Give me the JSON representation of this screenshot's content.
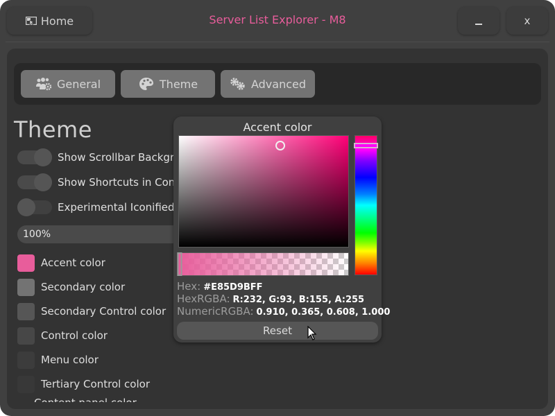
{
  "window": {
    "title": "Server List Explorer - M8",
    "home_label": "Home",
    "home_icon": "image-cursor-icon",
    "minimize_label": "_",
    "close_label": "x"
  },
  "tabs": [
    {
      "label": "General",
      "icon": "users-gear-icon",
      "active": false
    },
    {
      "label": "Theme",
      "icon": "palette-icon",
      "active": true
    },
    {
      "label": "Advanced",
      "icon": "gears-icon",
      "active": false
    }
  ],
  "section": {
    "title": "Theme"
  },
  "toggles": [
    {
      "label": "Show Scrollbar Background",
      "on": true
    },
    {
      "label": "Show Shortcuts in Context Menu",
      "on": true
    },
    {
      "label": "Experimental Iconified Menu",
      "on": false
    }
  ],
  "scale": {
    "value": "100%"
  },
  "colors": [
    {
      "label": "Accent color",
      "hex": "#e85d9b"
    },
    {
      "label": "Secondary color",
      "hex": "#737373"
    },
    {
      "label": "Secondary Control color",
      "hex": "#565656"
    },
    {
      "label": "Control color",
      "hex": "#474747"
    },
    {
      "label": "Menu color",
      "hex": "#3c3c3c"
    },
    {
      "label": "Tertiary Control color",
      "hex": "#383838"
    },
    {
      "label": "Content panel color",
      "hex": "#333333"
    }
  ],
  "picker": {
    "title": "Accent color",
    "hex_label": "Hex:",
    "hex_value": "#E85D9BFF",
    "hexrgba_label": "HexRGBA:",
    "hexrgba_value": "R:232, G:93, B:155, A:255",
    "numeric_label": "NumericRGBA:",
    "numeric_value": "0.910, 0.365, 0.608, 1.000",
    "reset_label": "Reset",
    "saturation": 0.6,
    "value": 0.91,
    "hue_fraction": 0.07,
    "alpha": 1.0,
    "selected_color": "#e85d9b"
  },
  "accent_color": "#e85d9b"
}
